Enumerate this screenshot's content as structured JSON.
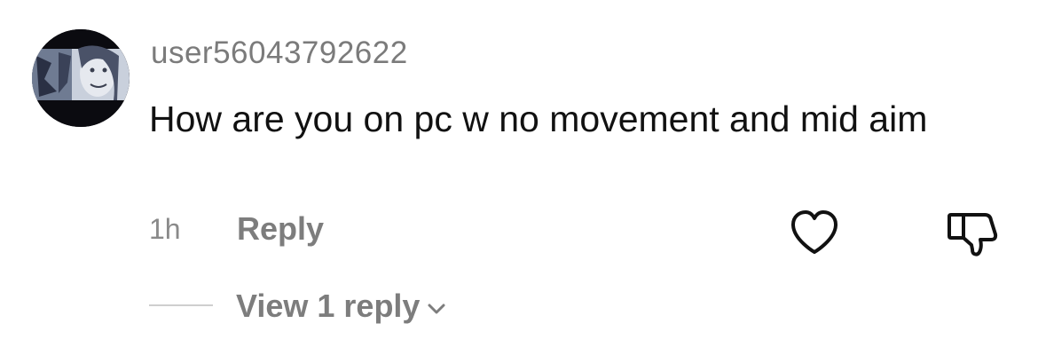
{
  "comment": {
    "username": "user56043792622",
    "text": "How are you on pc w no movement and mid aim",
    "timestamp": "1h",
    "reply_label": "Reply",
    "view_replies_label": "View 1 reply"
  },
  "icons": {
    "like": "heart-icon",
    "dislike": "thumbs-down-icon",
    "expand": "chevron-down-icon"
  },
  "colors": {
    "primary_text": "#111111",
    "secondary_text": "#7b7b7b",
    "divider": "#cfcfcf"
  }
}
